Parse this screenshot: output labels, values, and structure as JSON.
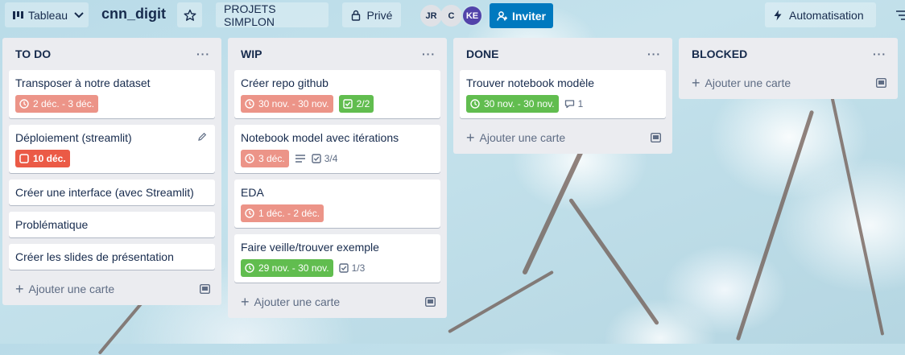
{
  "header": {
    "view_label": "Tableau",
    "board_title": "cnn_digit",
    "workspace": "PROJETS SIMPLON",
    "visibility": "Privé",
    "members": [
      "JR",
      "C",
      "KE"
    ],
    "invite_label": "Inviter",
    "automation_label": "Automatisation"
  },
  "lists": [
    {
      "title": "TO DO",
      "cards": [
        {
          "title": "Transposer à notre dataset",
          "date": "2 déc. - 3 déc."
        },
        {
          "title": "Déploiement (streamlit)",
          "date": "10 déc."
        },
        {
          "title": "Créer une interface (avec Streamlit)"
        },
        {
          "title": "Problématique"
        },
        {
          "title": "Créer les slides de présentation"
        }
      ],
      "add_label": "Ajouter une carte"
    },
    {
      "title": "WIP",
      "cards": [
        {
          "title": "Créer repo github",
          "date": "30 nov. - 30 nov.",
          "checklist": "2/2"
        },
        {
          "title": "Notebook model avec itérations",
          "date": "3 déc.",
          "checklist": "3/4"
        },
        {
          "title": "EDA",
          "date": "1 déc. - 2 déc."
        },
        {
          "title": "Faire veille/trouver exemple",
          "date": "29 nov. - 30 nov.",
          "checklist": "1/3"
        }
      ],
      "add_label": "Ajouter une carte"
    },
    {
      "title": "DONE",
      "cards": [
        {
          "title": "Trouver notebook modèle",
          "date": "30 nov. - 30 nov.",
          "comments": "1"
        }
      ],
      "add_label": "Ajouter une carte"
    },
    {
      "title": "BLOCKED",
      "cards": [],
      "add_label": "Ajouter une carte"
    }
  ],
  "colors": {
    "date_due_soon": "#ec9488",
    "date_overdue": "#eb5a46",
    "date_complete": "#61bd4f",
    "invite_button": "#0079bf"
  }
}
